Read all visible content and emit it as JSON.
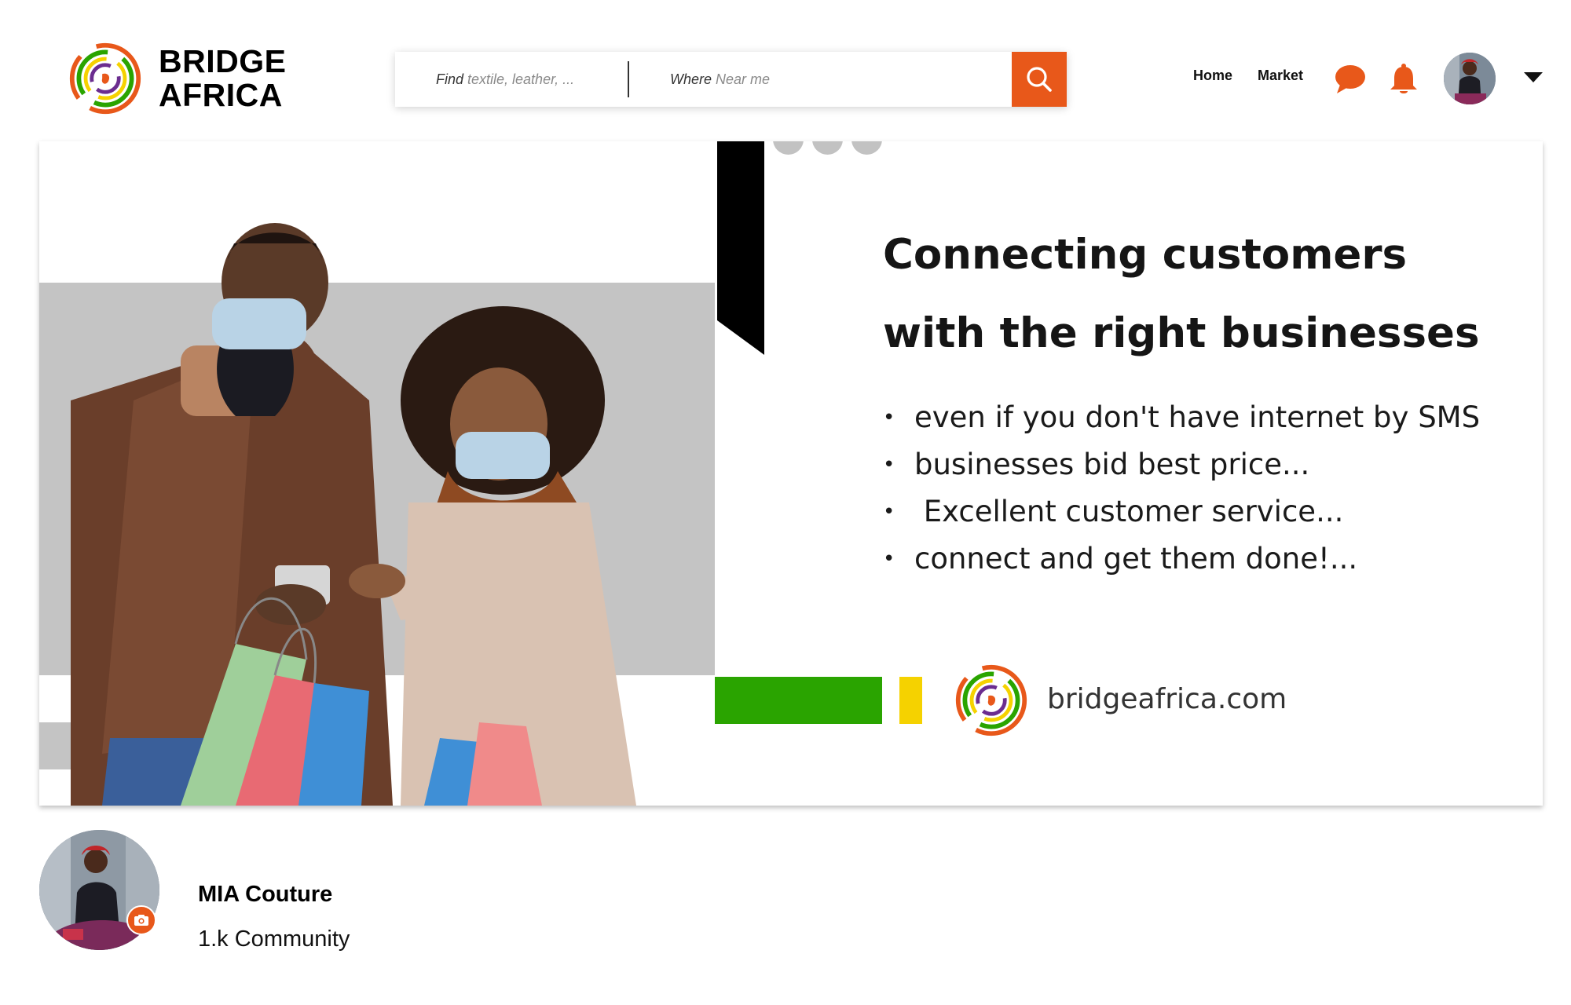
{
  "brand": {
    "name_line1": "BRIDGE",
    "name_line2": "AFRICA",
    "colors": {
      "orange": "#e8581a",
      "green": "#2aa400",
      "yellow": "#f5d200",
      "purple": "#6b2d8f"
    }
  },
  "search": {
    "find_label": "Find",
    "find_placeholder": "textile, leather, ...",
    "where_label": "Where",
    "where_placeholder": "Near me",
    "button_icon": "search-icon"
  },
  "nav": {
    "home": "Home",
    "market": "Market",
    "icons": [
      "chat-icon",
      "bell-icon",
      "avatar",
      "caret-down-icon"
    ]
  },
  "banner": {
    "headline_line1": "Connecting customers",
    "headline_line2": "with the right businesses",
    "bullets": [
      "even if you don't have internet by SMS",
      "businesses bid best price...",
      " Excellent customer service...",
      "connect and get them done!..."
    ],
    "url": "bridgeafrica.com",
    "slide_dots": 3
  },
  "profile": {
    "name": "MIA Couture",
    "community": "1.k Community"
  }
}
